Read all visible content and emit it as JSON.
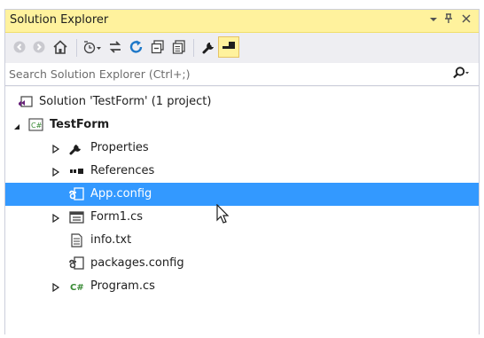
{
  "panel": {
    "title": "Solution Explorer",
    "controls": {
      "dropdown": "▾",
      "pin": "ᵖ",
      "close": "✕"
    }
  },
  "toolbar": {
    "buttons": [
      "back-icon",
      "forward-icon",
      "home-icon",
      "pending-changes-filter-icon",
      "sync-active-document-icon",
      "refresh-icon",
      "collapse-all-icon",
      "show-all-files-icon",
      "properties-icon",
      "preview-selected-items-icon"
    ]
  },
  "search": {
    "placeholder": "Search Solution Explorer (Ctrl+;)"
  },
  "tree": {
    "items": [
      {
        "label": "Solution 'TestForm' (1 project)",
        "icon": "solution-icon",
        "expander": "none"
      },
      {
        "label": "TestForm",
        "icon": "csharp-project-icon",
        "expander": "expanded",
        "bold": true
      },
      {
        "label": "Properties",
        "icon": "wrench-icon",
        "expander": "collapsed"
      },
      {
        "label": "References",
        "icon": "references-icon",
        "expander": "collapsed"
      },
      {
        "label": "App.config",
        "icon": "config-file-icon",
        "expander": "none",
        "selected": true
      },
      {
        "label": "Form1.cs",
        "icon": "form-icon",
        "expander": "collapsed"
      },
      {
        "label": "info.txt",
        "icon": "text-file-icon",
        "expander": "none"
      },
      {
        "label": "packages.config",
        "icon": "config-file-icon",
        "expander": "none"
      },
      {
        "label": "Program.cs",
        "icon": "csharp-file-icon",
        "expander": "collapsed"
      }
    ]
  },
  "colors": {
    "title_bg": "#fff29d",
    "selection": "#3399ff",
    "accent_blue": "#1e78c8"
  }
}
